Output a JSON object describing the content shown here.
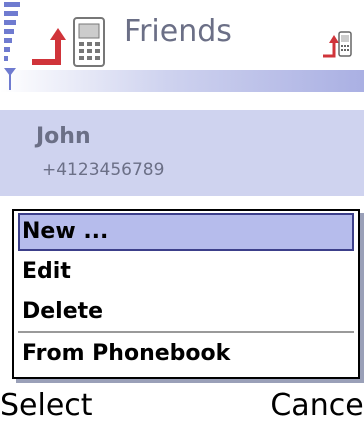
{
  "header": {
    "title": "Friends"
  },
  "contact": {
    "name": "John",
    "phone": "+4123456789"
  },
  "options_menu": {
    "items": [
      {
        "label": "New ..."
      },
      {
        "label": "Edit"
      },
      {
        "label": "Delete"
      },
      {
        "label": "From Phonebook"
      }
    ],
    "selected_index": 0
  },
  "softkeys": {
    "left": "Select",
    "right": "Cancel"
  },
  "colors": {
    "highlight": "#b6bcec",
    "card_background": "#cfd3ef",
    "muted_text": "#6b6f86"
  }
}
